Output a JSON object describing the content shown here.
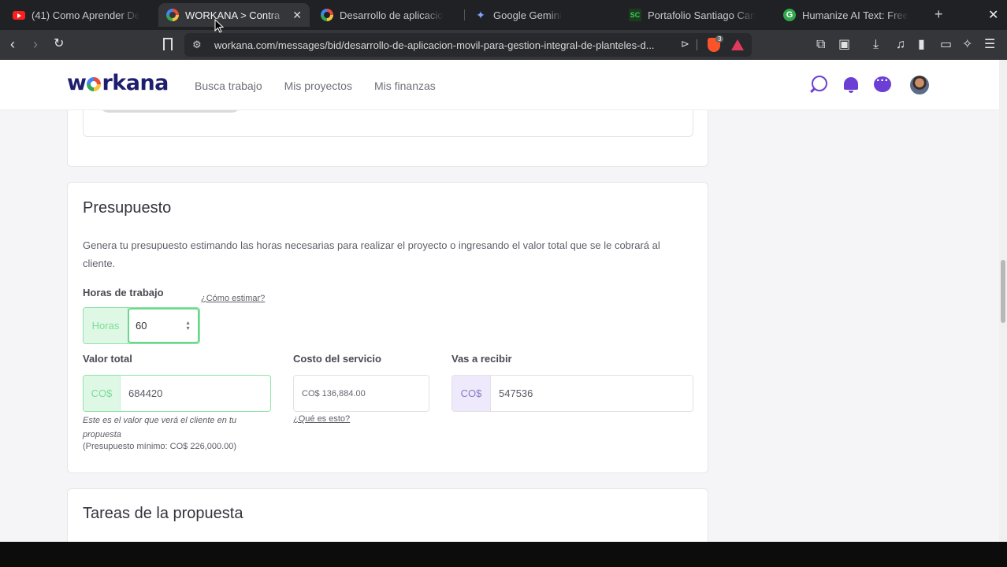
{
  "browser": {
    "tabs": [
      {
        "label": "(41) Como Aprender De",
        "favicon": "youtube-icon"
      },
      {
        "label": "WORKANA > Contra",
        "favicon": "workana-icon",
        "active": true
      },
      {
        "label": "Desarrollo de aplicacio",
        "favicon": "workana-icon"
      },
      {
        "label": "Google Gemini",
        "favicon": "gemini-icon"
      },
      {
        "label": "Portafolio Santiago Can",
        "favicon": "sc-icon"
      },
      {
        "label": "Humanize AI Text: Free",
        "favicon": "g-icon"
      }
    ],
    "url": "workana.com/messages/bid/desarrollo-de-aplicacion-movil-para-gestion-integral-de-planteles-d...",
    "brave_badge": "3"
  },
  "header": {
    "logo": "workana",
    "nav": [
      "Busca trabajo",
      "Mis proyectos",
      "Mis finanzas"
    ]
  },
  "budget": {
    "title": "Presupuesto",
    "description": "Genera tu presupuesto estimando las horas necesarias para realizar el proyecto o ingresando el valor total que se le cobrará al cliente.",
    "hours_label": "Horas de trabajo",
    "estimate_link": "¿Cómo estimar?",
    "hours_addon": "Horas",
    "hours_value": "60",
    "total_label": "Valor total",
    "total_addon": "CO$",
    "total_value": "684420",
    "total_hint": "Este es el valor que verá el cliente en tu propuesta",
    "min_budget": "(Presupuesto mínimo: CO$ 226,000.00)",
    "cost_label": "Costo del servicio",
    "cost_value": "CO$ 136,884.00",
    "cost_link": "¿Qué es esto?",
    "receive_label": "Vas a recibir",
    "receive_addon": "CO$",
    "receive_value": "547536"
  },
  "tasks": {
    "title": "Tareas de la propuesta"
  },
  "colors": {
    "brand_purple": "#6b3fd4",
    "success_green": "#6dd68b",
    "logo_navy": "#1e1e6e"
  }
}
